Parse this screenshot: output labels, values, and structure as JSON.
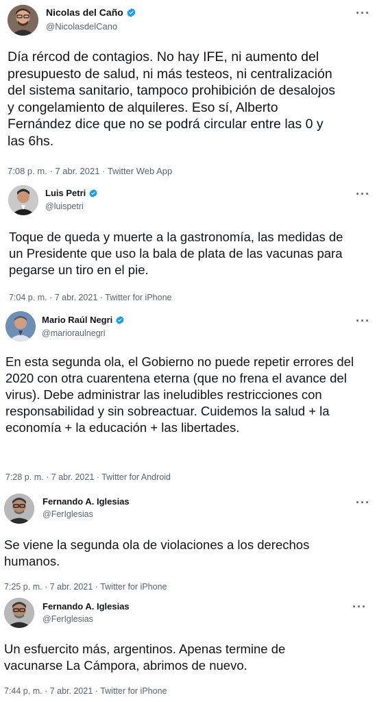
{
  "tweets": [
    {
      "name": "Nicolas del Caño",
      "handle": "@NicolasdelCano",
      "verified": true,
      "text": "Día rércod de contagios. No hay IFE, ni aumento del presupuesto de salud, ni más testeos, ni centralización del sistema sanitario, tampoco prohibición de desalojos y congelamiento de alquileres. Eso sí, Alberto Fernández dice que no se podrá circular entre las 0 y las 6hs.",
      "time": "7:08 p. m.",
      "date": "7 abr. 2021",
      "client": "Twitter Web App",
      "more_icon": "more-icon"
    },
    {
      "name": "Luis Petri",
      "handle": "@luispetri",
      "verified": true,
      "text": "Toque de queda y muerte a la gastronomía, las medidas de un Presidente que uso la bala de plata de las vacunas para pegarse un tiro en el pie.",
      "time": "7:04 p. m.",
      "date": "7 abr. 2021",
      "client": "Twitter for iPhone",
      "more_icon": "more-icon"
    },
    {
      "name": "Mario Raúl Negri",
      "handle": "@marioraulnegri",
      "verified": true,
      "text": "En esta segunda ola, el Gobierno no puede repetir errores del 2020 con otra cuarentena eterna (que no frena el avance del virus). Debe administrar las ineludibles restricciones con responsabilidad y sin sobreactuar. Cuidemos la salud + la economía + la educación + las libertades.",
      "time": "7:28 p. m.",
      "date": "7 abr. 2021",
      "client": "Twitter for Android",
      "more_icon": "more-icon"
    },
    {
      "name": "Fernando A. Iglesias",
      "handle": "@FerIglesias",
      "verified": false,
      "text": "Se viene la segunda ola de violaciones a los derechos humanos.",
      "time": "7:25 p. m.",
      "date": "7 abr. 2021",
      "client": "Twitter for iPhone",
      "more_icon": "more-icon"
    },
    {
      "name": "Fernando A. Iglesias",
      "handle": "@FerIglesias",
      "verified": false,
      "text": "Un esfuercito más, argentinos. Apenas termine de vacunarse La Cámpora, abrimos de nuevo.",
      "time": "7:44 p. m.",
      "date": "7 abr. 2021",
      "client": "Twitter for iPhone",
      "more_icon": "more-icon"
    }
  ],
  "separator": "·",
  "colors": {
    "text": "#0f1419",
    "secondary": "#536471",
    "verified": "#1d9bf0"
  }
}
